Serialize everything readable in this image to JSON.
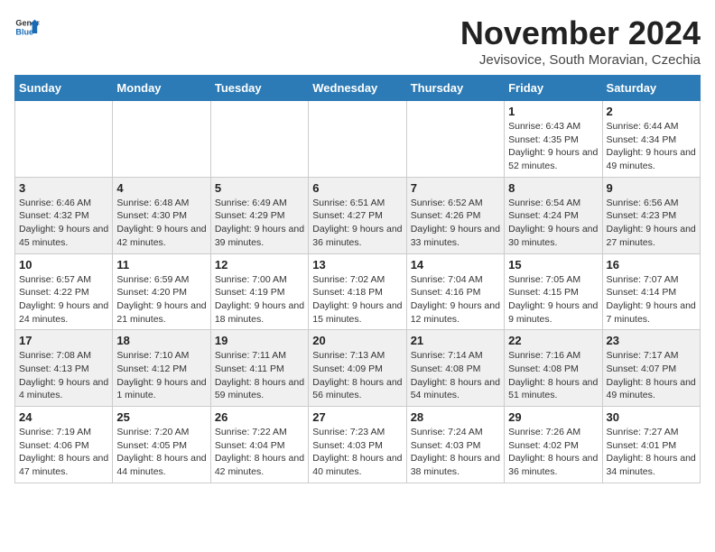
{
  "header": {
    "logo_general": "General",
    "logo_blue": "Blue",
    "title": "November 2024",
    "location": "Jevisovice, South Moravian, Czechia"
  },
  "days_of_week": [
    "Sunday",
    "Monday",
    "Tuesday",
    "Wednesday",
    "Thursday",
    "Friday",
    "Saturday"
  ],
  "weeks": [
    [
      {
        "day": "",
        "info": ""
      },
      {
        "day": "",
        "info": ""
      },
      {
        "day": "",
        "info": ""
      },
      {
        "day": "",
        "info": ""
      },
      {
        "day": "",
        "info": ""
      },
      {
        "day": "1",
        "info": "Sunrise: 6:43 AM\nSunset: 4:35 PM\nDaylight: 9 hours and 52 minutes."
      },
      {
        "day": "2",
        "info": "Sunrise: 6:44 AM\nSunset: 4:34 PM\nDaylight: 9 hours and 49 minutes."
      }
    ],
    [
      {
        "day": "3",
        "info": "Sunrise: 6:46 AM\nSunset: 4:32 PM\nDaylight: 9 hours and 45 minutes."
      },
      {
        "day": "4",
        "info": "Sunrise: 6:48 AM\nSunset: 4:30 PM\nDaylight: 9 hours and 42 minutes."
      },
      {
        "day": "5",
        "info": "Sunrise: 6:49 AM\nSunset: 4:29 PM\nDaylight: 9 hours and 39 minutes."
      },
      {
        "day": "6",
        "info": "Sunrise: 6:51 AM\nSunset: 4:27 PM\nDaylight: 9 hours and 36 minutes."
      },
      {
        "day": "7",
        "info": "Sunrise: 6:52 AM\nSunset: 4:26 PM\nDaylight: 9 hours and 33 minutes."
      },
      {
        "day": "8",
        "info": "Sunrise: 6:54 AM\nSunset: 4:24 PM\nDaylight: 9 hours and 30 minutes."
      },
      {
        "day": "9",
        "info": "Sunrise: 6:56 AM\nSunset: 4:23 PM\nDaylight: 9 hours and 27 minutes."
      }
    ],
    [
      {
        "day": "10",
        "info": "Sunrise: 6:57 AM\nSunset: 4:22 PM\nDaylight: 9 hours and 24 minutes."
      },
      {
        "day": "11",
        "info": "Sunrise: 6:59 AM\nSunset: 4:20 PM\nDaylight: 9 hours and 21 minutes."
      },
      {
        "day": "12",
        "info": "Sunrise: 7:00 AM\nSunset: 4:19 PM\nDaylight: 9 hours and 18 minutes."
      },
      {
        "day": "13",
        "info": "Sunrise: 7:02 AM\nSunset: 4:18 PM\nDaylight: 9 hours and 15 minutes."
      },
      {
        "day": "14",
        "info": "Sunrise: 7:04 AM\nSunset: 4:16 PM\nDaylight: 9 hours and 12 minutes."
      },
      {
        "day": "15",
        "info": "Sunrise: 7:05 AM\nSunset: 4:15 PM\nDaylight: 9 hours and 9 minutes."
      },
      {
        "day": "16",
        "info": "Sunrise: 7:07 AM\nSunset: 4:14 PM\nDaylight: 9 hours and 7 minutes."
      }
    ],
    [
      {
        "day": "17",
        "info": "Sunrise: 7:08 AM\nSunset: 4:13 PM\nDaylight: 9 hours and 4 minutes."
      },
      {
        "day": "18",
        "info": "Sunrise: 7:10 AM\nSunset: 4:12 PM\nDaylight: 9 hours and 1 minute."
      },
      {
        "day": "19",
        "info": "Sunrise: 7:11 AM\nSunset: 4:11 PM\nDaylight: 8 hours and 59 minutes."
      },
      {
        "day": "20",
        "info": "Sunrise: 7:13 AM\nSunset: 4:09 PM\nDaylight: 8 hours and 56 minutes."
      },
      {
        "day": "21",
        "info": "Sunrise: 7:14 AM\nSunset: 4:08 PM\nDaylight: 8 hours and 54 minutes."
      },
      {
        "day": "22",
        "info": "Sunrise: 7:16 AM\nSunset: 4:08 PM\nDaylight: 8 hours and 51 minutes."
      },
      {
        "day": "23",
        "info": "Sunrise: 7:17 AM\nSunset: 4:07 PM\nDaylight: 8 hours and 49 minutes."
      }
    ],
    [
      {
        "day": "24",
        "info": "Sunrise: 7:19 AM\nSunset: 4:06 PM\nDaylight: 8 hours and 47 minutes."
      },
      {
        "day": "25",
        "info": "Sunrise: 7:20 AM\nSunset: 4:05 PM\nDaylight: 8 hours and 44 minutes."
      },
      {
        "day": "26",
        "info": "Sunrise: 7:22 AM\nSunset: 4:04 PM\nDaylight: 8 hours and 42 minutes."
      },
      {
        "day": "27",
        "info": "Sunrise: 7:23 AM\nSunset: 4:03 PM\nDaylight: 8 hours and 40 minutes."
      },
      {
        "day": "28",
        "info": "Sunrise: 7:24 AM\nSunset: 4:03 PM\nDaylight: 8 hours and 38 minutes."
      },
      {
        "day": "29",
        "info": "Sunrise: 7:26 AM\nSunset: 4:02 PM\nDaylight: 8 hours and 36 minutes."
      },
      {
        "day": "30",
        "info": "Sunrise: 7:27 AM\nSunset: 4:01 PM\nDaylight: 8 hours and 34 minutes."
      }
    ]
  ]
}
